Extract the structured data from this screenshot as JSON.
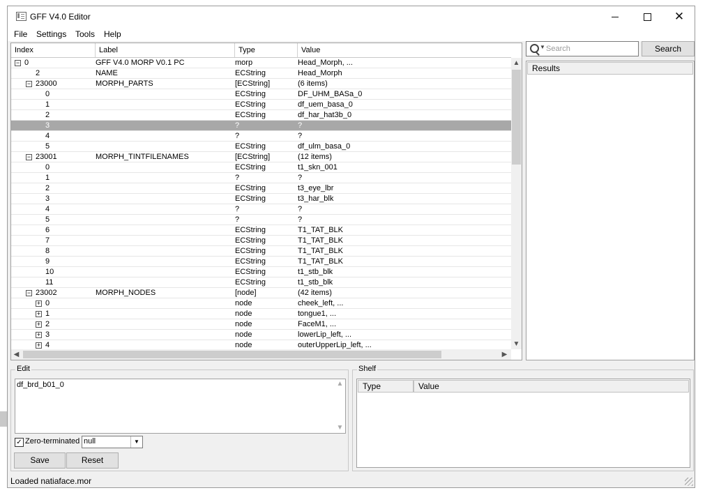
{
  "window": {
    "title": "GFF V4.0 Editor"
  },
  "menu": [
    "File",
    "Settings",
    "Tools",
    "Help"
  ],
  "tree": {
    "columns": [
      "Index",
      "Label",
      "Type",
      "Value"
    ],
    "rows": [
      {
        "index": "0",
        "depth": 0,
        "expander": "minus",
        "label": "GFF  V4.0 MORP V0.1 PC",
        "type": "morp",
        "value": "Head_Morph, ..."
      },
      {
        "index": "2",
        "depth": 1,
        "expander": "",
        "label": "NAME",
        "type": "ECString",
        "value": "Head_Morph"
      },
      {
        "index": "23000",
        "depth": 1,
        "expander": "minus",
        "label": "MORPH_PARTS",
        "type": "[ECString]",
        "value": "(6 items)"
      },
      {
        "index": "0",
        "depth": 2,
        "expander": "",
        "label": "",
        "type": "ECString",
        "value": "DF_UHM_BASa_0"
      },
      {
        "index": "1",
        "depth": 2,
        "expander": "",
        "label": "",
        "type": "ECString",
        "value": "df_uem_basa_0"
      },
      {
        "index": "2",
        "depth": 2,
        "expander": "",
        "label": "",
        "type": "ECString",
        "value": "df_har_hat3b_0"
      },
      {
        "index": "3",
        "depth": 2,
        "expander": "",
        "label": "",
        "type": "?",
        "value": "?",
        "selected": true
      },
      {
        "index": "4",
        "depth": 2,
        "expander": "",
        "label": "",
        "type": "?",
        "value": "?"
      },
      {
        "index": "5",
        "depth": 2,
        "expander": "",
        "label": "",
        "type": "ECString",
        "value": "df_ulm_basa_0"
      },
      {
        "index": "23001",
        "depth": 1,
        "expander": "minus",
        "label": "MORPH_TINTFILENAMES",
        "type": "[ECString]",
        "value": "(12 items)"
      },
      {
        "index": "0",
        "depth": 2,
        "expander": "",
        "label": "",
        "type": "ECString",
        "value": "t1_skn_001"
      },
      {
        "index": "1",
        "depth": 2,
        "expander": "",
        "label": "",
        "type": "?",
        "value": "?"
      },
      {
        "index": "2",
        "depth": 2,
        "expander": "",
        "label": "",
        "type": "ECString",
        "value": "t3_eye_lbr"
      },
      {
        "index": "3",
        "depth": 2,
        "expander": "",
        "label": "",
        "type": "ECString",
        "value": "t3_har_blk"
      },
      {
        "index": "4",
        "depth": 2,
        "expander": "",
        "label": "",
        "type": "?",
        "value": "?"
      },
      {
        "index": "5",
        "depth": 2,
        "expander": "",
        "label": "",
        "type": "?",
        "value": "?"
      },
      {
        "index": "6",
        "depth": 2,
        "expander": "",
        "label": "",
        "type": "ECString",
        "value": "T1_TAT_BLK"
      },
      {
        "index": "7",
        "depth": 2,
        "expander": "",
        "label": "",
        "type": "ECString",
        "value": "T1_TAT_BLK"
      },
      {
        "index": "8",
        "depth": 2,
        "expander": "",
        "label": "",
        "type": "ECString",
        "value": "T1_TAT_BLK"
      },
      {
        "index": "9",
        "depth": 2,
        "expander": "",
        "label": "",
        "type": "ECString",
        "value": "T1_TAT_BLK"
      },
      {
        "index": "10",
        "depth": 2,
        "expander": "",
        "label": "",
        "type": "ECString",
        "value": "t1_stb_blk"
      },
      {
        "index": "11",
        "depth": 2,
        "expander": "",
        "label": "",
        "type": "ECString",
        "value": "t1_stb_blk"
      },
      {
        "index": "23002",
        "depth": 1,
        "expander": "minus",
        "label": "MORPH_NODES",
        "type": "[node]",
        "value": "(42 items)"
      },
      {
        "index": "0",
        "depth": 2,
        "expander": "plus",
        "label": "",
        "type": "node",
        "value": "cheek_left, ..."
      },
      {
        "index": "1",
        "depth": 2,
        "expander": "plus",
        "label": "",
        "type": "node",
        "value": "tongue1, ..."
      },
      {
        "index": "2",
        "depth": 2,
        "expander": "plus",
        "label": "",
        "type": "node",
        "value": "FaceM1, ..."
      },
      {
        "index": "3",
        "depth": 2,
        "expander": "plus",
        "label": "",
        "type": "node",
        "value": "lowerLip_left, ..."
      },
      {
        "index": "4",
        "depth": 2,
        "expander": "plus",
        "label": "",
        "type": "node",
        "value": "outerUpperLip_left, ..."
      }
    ]
  },
  "search": {
    "placeholder": "Search",
    "button_label": "Search"
  },
  "results": {
    "header": "Results"
  },
  "edit": {
    "title": "Edit",
    "value": "df_brd_b01_0",
    "zero_terminated_label": "Zero-terminated",
    "zero_terminated_checked": true,
    "terminator_value": "null",
    "save_label": "Save",
    "reset_label": "Reset"
  },
  "shelf": {
    "title": "Shelf",
    "columns": [
      "Type",
      "Value"
    ]
  },
  "status": {
    "text": "Loaded natiaface.mor"
  },
  "colors": {
    "selected_row": "#a8a8a8",
    "window_bg": "#f0f0f0"
  }
}
